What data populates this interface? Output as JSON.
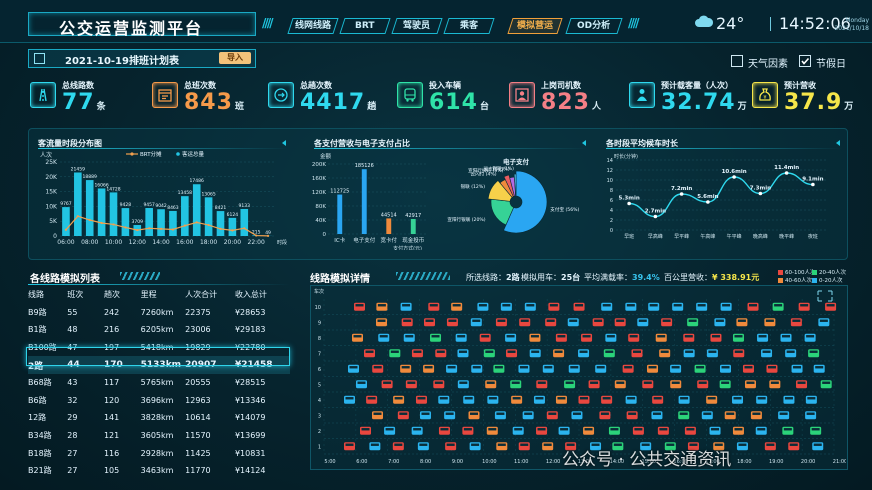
{
  "header": {
    "title": "公交运营监测平台",
    "nav": [
      {
        "label": "线网线路",
        "active": false
      },
      {
        "label": "BRT",
        "active": false
      },
      {
        "label": "驾驶员",
        "active": false
      },
      {
        "label": "乘客",
        "active": false
      },
      {
        "label": "模拟营运",
        "active": true
      },
      {
        "label": "OD分析",
        "active": false
      }
    ],
    "weather_icon": "cloud-icon",
    "temperature": "24°",
    "time": "14:52:06",
    "weekday": "Monday",
    "date": "2021/10/18"
  },
  "plan": {
    "label": "2021-10-19排班计划表",
    "import_label": "导入"
  },
  "toggles": [
    {
      "label": "天气因素",
      "checked": false
    },
    {
      "label": "节假日",
      "checked": true
    }
  ],
  "kpis": [
    {
      "label": "总线路数",
      "value": "77",
      "unit": "条",
      "color": "#2fd9ee",
      "icon": "road-icon"
    },
    {
      "label": "总班次数",
      "value": "843",
      "unit": "班",
      "color": "#f59a4a",
      "icon": "schedule-icon"
    },
    {
      "label": "总趟次数",
      "value": "4417",
      "unit": "趟",
      "color": "#2fd9ee",
      "icon": "trip-icon"
    },
    {
      "label": "投入车辆",
      "value": "614",
      "unit": "台",
      "color": "#2fe3a8",
      "icon": "bus-icon"
    },
    {
      "label": "上岗司机数",
      "value": "823",
      "unit": "人",
      "color": "#f47f86",
      "icon": "driver-icon"
    },
    {
      "label": "预计载客量（人次）",
      "value": "32.74",
      "unit": "万",
      "color": "#2fd9ee",
      "icon": "passenger-icon"
    },
    {
      "label": "预计营收",
      "value": "37.9",
      "unit": "万",
      "color": "#f6e64a",
      "icon": "money-bag-icon"
    }
  ],
  "charts_titles": {
    "flow": "客流量时段分布图",
    "payment": "各支付营收与电子支付占比",
    "interval": "各时段平均候车时长"
  },
  "chart_data": [
    {
      "type": "bar",
      "title": "客流量时段分布图",
      "ylabel": "人次",
      "xlabel": "时段",
      "ylim": [
        0,
        25000
      ],
      "yticks": [
        "0",
        "5K",
        "10K",
        "15K",
        "20K",
        "25K"
      ],
      "categories": [
        "06:00",
        "07:00",
        "08:00",
        "09:00",
        "10:00",
        "11:00",
        "12:00",
        "13:00",
        "14:00",
        "15:00",
        "16:00",
        "17:00",
        "18:00",
        "19:00",
        "20:00",
        "21:00",
        "22:00",
        "23:00"
      ],
      "x_tick_labels": [
        "06:00",
        "08:00",
        "10:00",
        "12:00",
        "14:00",
        "16:00",
        "18:00",
        "20:00",
        "22:00"
      ],
      "legend": [
        "BRT分摊",
        "客运总量"
      ],
      "series": [
        {
          "name": "客运总量",
          "values": [
            9767,
            21459,
            18889,
            16066,
            14728,
            9428,
            3709,
            9457,
            9042,
            8463,
            13458,
            17486,
            13065,
            8421,
            6124,
            9133,
            215,
            49
          ]
        },
        {
          "name": "BRT分摊",
          "values": [
            2100,
            6700,
            5400,
            4400,
            3900,
            2900,
            2000,
            2600,
            2400,
            2200,
            3500,
            4600,
            3700,
            2400,
            1900,
            2600,
            150,
            40
          ]
        }
      ]
    },
    {
      "type": "bar",
      "title": "各支付营收与电子支付占比",
      "ylabel": "金额",
      "xlabel": "支付方式(元)",
      "ylim": [
        0,
        200000
      ],
      "yticks": [
        "0",
        "40K",
        "80K",
        "120K",
        "160K",
        "200K"
      ],
      "categories": [
        "IC卡",
        "电子支付",
        "宽卡付",
        "现金投币"
      ],
      "values": [
        112725,
        185126,
        44514,
        42917
      ]
    },
    {
      "type": "pie",
      "title": "电子支付",
      "slices": [
        {
          "label": "支付宝",
          "value": 56,
          "color": "#2aa6f2"
        },
        {
          "label": "宣阳行银联",
          "value": 20,
          "color": "#36d296"
        },
        {
          "label": "银联",
          "value": 12,
          "color": "#f7d04a"
        },
        {
          "label": "云闪付",
          "value": 4,
          "color": "#f08a3c"
        },
        {
          "label": "宣阳行扫码",
          "value": 3,
          "color": "#e95c60"
        },
        {
          "label": "翼支付",
          "value": 3,
          "color": "#b26be2"
        },
        {
          "label": "银联",
          "value": 1,
          "color": "#58d0ff"
        }
      ],
      "slice_labels": [
        "支付宝 (56%)",
        "宣阳行银联 (20%)",
        "银联 (12%)",
        "云闪付 (4%)",
        "宣阳行扫码 (3%)",
        "翼支付 (3%)",
        "银联 (1%)"
      ]
    },
    {
      "type": "line",
      "title": "各时段平均候车时长",
      "ylabel": "时长(分钟)",
      "yticks": [
        "0",
        "2",
        "4",
        "6",
        "8",
        "10",
        "12",
        "14"
      ],
      "ylim": [
        0,
        14
      ],
      "categories": [
        "早班",
        "早高峰",
        "早平峰",
        "午高峰",
        "午平峰",
        "晚高峰",
        "晚平峰",
        "夜班"
      ],
      "values": [
        5.3,
        2.7,
        7.2,
        5.6,
        10.6,
        7.3,
        11.4,
        9.1
      ],
      "point_labels": [
        "5.3min",
        "2.7min",
        "7.2min",
        "5.6min",
        "10.6min",
        "7.3min",
        "11.4min",
        "9.1min"
      ]
    }
  ],
  "route_list": {
    "title": "各线路模拟列表",
    "columns": [
      "线路",
      "班次",
      "趟次",
      "里程",
      "人次合计",
      "收入总计"
    ],
    "rows": [
      [
        "B9路",
        "55",
        "242",
        "7260km",
        "22375",
        "¥28653"
      ],
      [
        "B1路",
        "48",
        "216",
        "6205km",
        "23006",
        "¥29183"
      ],
      [
        "B100路",
        "47",
        "197",
        "5418km",
        "19829",
        "¥22780"
      ],
      [
        "2路",
        "44",
        "170",
        "5133km",
        "20907",
        "¥21458"
      ],
      [
        "B68路",
        "43",
        "117",
        "5765km",
        "20555",
        "¥28515"
      ],
      [
        "B6路",
        "32",
        "120",
        "3696km",
        "12963",
        "¥13346"
      ],
      [
        "12路",
        "29",
        "141",
        "3828km",
        "10614",
        "¥14079"
      ],
      [
        "B34路",
        "28",
        "121",
        "3605km",
        "11570",
        "¥13699"
      ],
      [
        "B18路",
        "27",
        "116",
        "2928km",
        "11425",
        "¥10831"
      ],
      [
        "B21路",
        "27",
        "105",
        "3463km",
        "11770",
        "¥14124"
      ]
    ],
    "selected_index": 3
  },
  "route_detail": {
    "title": "线路模拟详情",
    "selected_route_label": "所选线路：",
    "selected_route": "2路",
    "sim_vehicles_label": "模拟用车：",
    "sim_vehicles": "25台",
    "avg_load_label": "平均满载率：",
    "avg_load": "39.4%",
    "revenue_label": "百公里营收：",
    "revenue": "¥ 338.91元",
    "legend": [
      {
        "label": "60-100人次",
        "color": "#e9473f"
      },
      {
        "label": "20-40人次",
        "color": "#2bd37a"
      },
      {
        "label": "40-60人次",
        "color": "#f08a3c"
      },
      {
        "label": "0-20人次",
        "color": "#2bb4ef"
      }
    ],
    "ylabel": "车次",
    "y_ticks": [
      "1",
      "2",
      "3",
      "4",
      "5",
      "6",
      "7",
      "8",
      "9",
      "10"
    ],
    "x_ticks": [
      "5:00",
      "6:00",
      "7:00",
      "8:00",
      "9:00",
      "10:00",
      "11:00",
      "12:00",
      "13:00",
      "14:00",
      "15:00",
      "16:00",
      "17:00",
      "18:00",
      "19:00",
      "20:00",
      "21:00"
    ]
  },
  "watermark": "公众号 · 公共交通资讯"
}
